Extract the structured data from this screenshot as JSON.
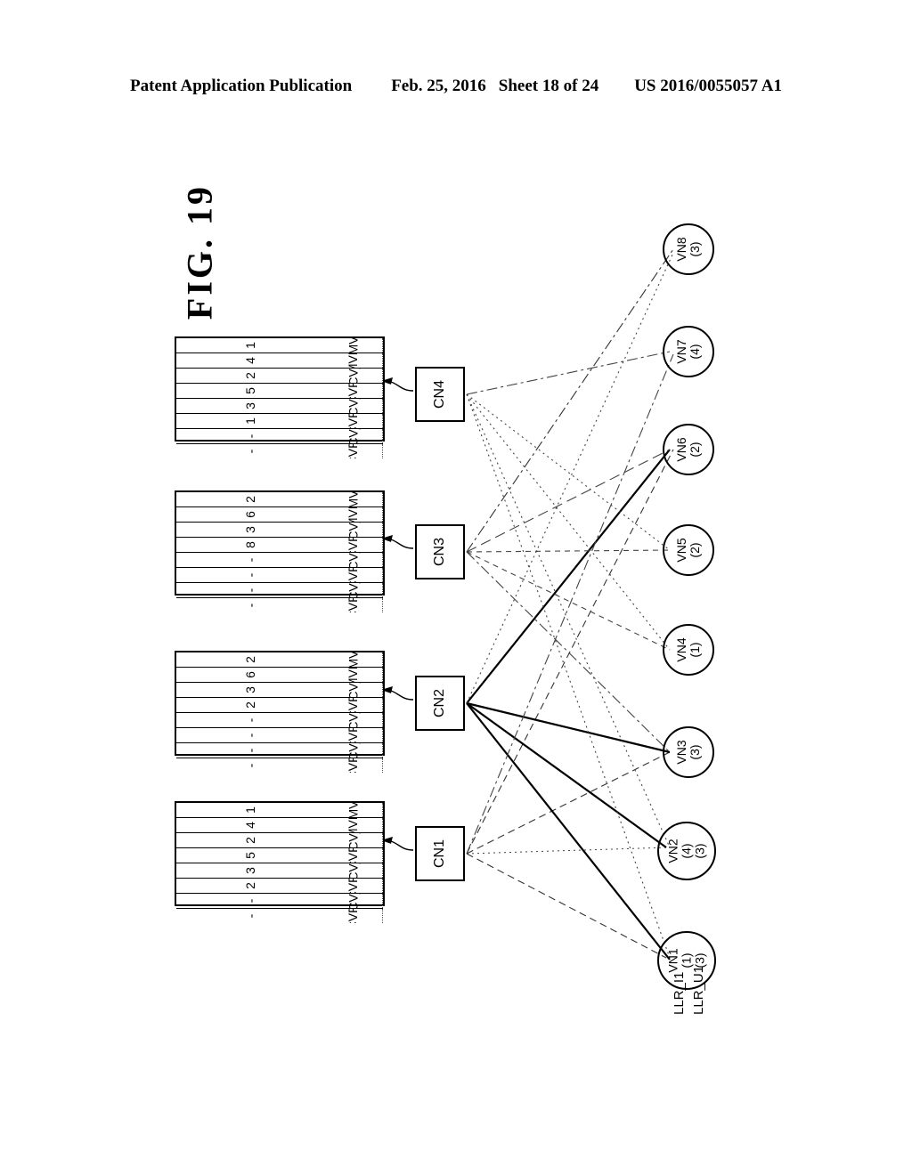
{
  "header": {
    "publication": "Patent Application Publication",
    "date": "Feb. 25, 2016",
    "sheet": "Sheet 18 of 24",
    "number": "US 2016/0055057 A1"
  },
  "figure": {
    "title": "FIG.  19"
  },
  "tables": {
    "row_labels": [
      "MV",
      "MVP",
      "MCV_1",
      "MCVP_1",
      "MCV_2",
      "MCVP_2",
      "MCV_3",
      "MCVP_3"
    ],
    "items": [
      {
        "id": "cn4-table",
        "owner": "CN4",
        "values": [
          "1",
          "4",
          "2",
          "5",
          "3",
          "1",
          "-",
          "-"
        ]
      },
      {
        "id": "cn3-table",
        "owner": "CN3",
        "values": [
          "2",
          "6",
          "3",
          "8",
          "-",
          "-",
          "-",
          "-"
        ]
      },
      {
        "id": "cn2-table",
        "owner": "CN2",
        "values": [
          "2",
          "6",
          "3",
          "2",
          "-",
          "-",
          "-",
          "-"
        ]
      },
      {
        "id": "cn1-table",
        "owner": "CN1",
        "values": [
          "1",
          "4",
          "2",
          "5",
          "3",
          "2",
          "-",
          "-"
        ]
      }
    ]
  },
  "check_nodes": [
    {
      "id": "CN4",
      "label": "CN4"
    },
    {
      "id": "CN3",
      "label": "CN3"
    },
    {
      "id": "CN2",
      "label": "CN2"
    },
    {
      "id": "CN1",
      "label": "CN1"
    }
  ],
  "variable_nodes": [
    {
      "id": "VN8",
      "label": "VN8",
      "value": "(3)",
      "value2": ""
    },
    {
      "id": "VN7",
      "label": "VN7",
      "value": "(4)",
      "value2": ""
    },
    {
      "id": "VN6",
      "label": "VN6",
      "value": "(2)",
      "value2": ""
    },
    {
      "id": "VN5",
      "label": "VN5",
      "value": "(2)",
      "value2": ""
    },
    {
      "id": "VN4",
      "label": "VN4",
      "value": "(1)",
      "value2": ""
    },
    {
      "id": "VN3",
      "label": "VN3",
      "value": "(3)",
      "value2": ""
    },
    {
      "id": "VN2",
      "label": "VN2",
      "value": "(4)",
      "value2": "(3)"
    },
    {
      "id": "VN1",
      "label": "VN1",
      "value": "(1)",
      "value2": "(3)"
    }
  ],
  "llr_labels": {
    "initial": "LLR_I1",
    "updated": "LLR_U1"
  },
  "colors": {
    "ink": "#000000",
    "paper": "#ffffff",
    "faint": "#555555"
  }
}
